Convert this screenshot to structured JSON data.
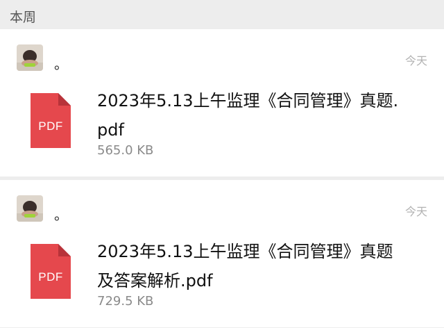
{
  "section": {
    "title": "本周"
  },
  "files": [
    {
      "sender": "。",
      "time": "今天",
      "icon_label": "PDF",
      "name": "2023年5.13上午监理《合同管理》真题.pdf",
      "size": "565.0 KB"
    },
    {
      "sender": "。",
      "time": "今天",
      "icon_label": "PDF",
      "name": "2023年5.13上午监理《合同管理》真题及答案解析.pdf",
      "size": "729.5 KB"
    }
  ],
  "colors": {
    "pdf_red": "#e5484d",
    "pdf_fold": "#b8333a",
    "background": "#ededed"
  }
}
